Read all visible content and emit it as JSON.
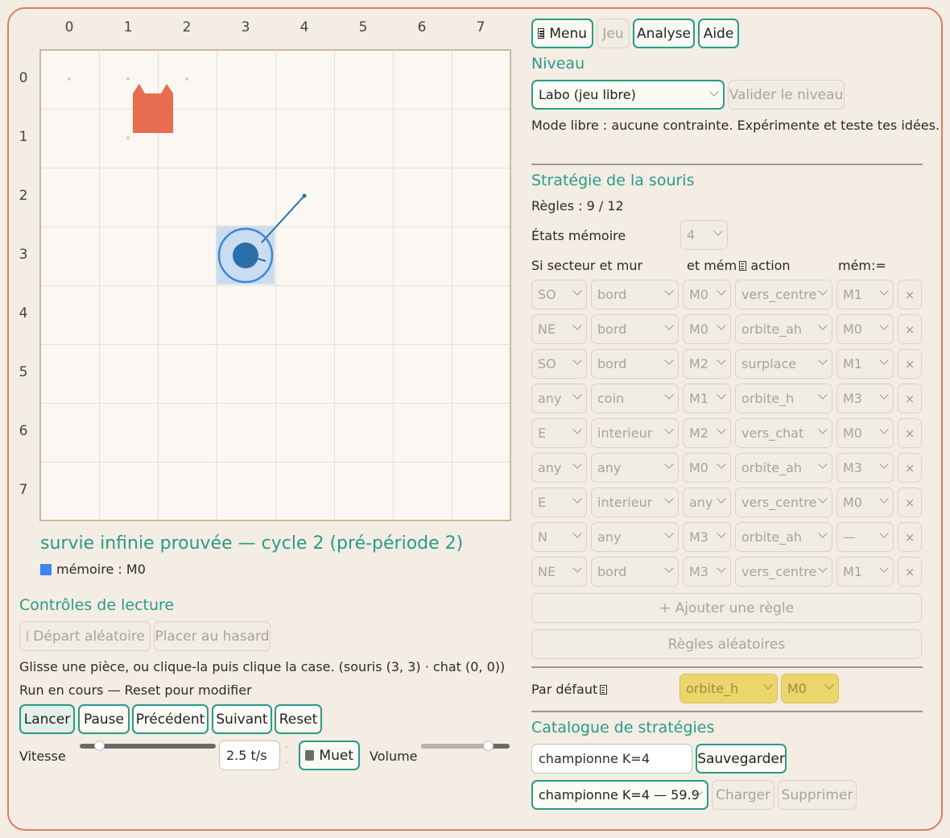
{
  "top_nav": {
    "menu": "Menu",
    "jeu": "Jeu",
    "analyse": "Analyse",
    "aide": "Aide"
  },
  "board": {
    "col_labels": [
      "0",
      "1",
      "2",
      "3",
      "4",
      "5",
      "6",
      "7"
    ],
    "row_labels": [
      "0",
      "1",
      "2",
      "3",
      "4",
      "5",
      "6",
      "7"
    ],
    "status": "survie infinie prouvée — cycle 2 (pré-période 2)",
    "memory": "mémoire : M0",
    "mouse_cell": [
      3,
      3
    ],
    "cat_cell": [
      1,
      0
    ],
    "colors": {
      "cat": "#e86c4f",
      "mouse": "#2a6fa8",
      "mouse_highlight": "#c9dcf0",
      "memory_square": "#3b82f6",
      "accent": "#2a9a8a"
    }
  },
  "controls": {
    "title": "Contrôles de lecture",
    "random_start": "Départ aléatoire",
    "place_random": "Placer au hasard",
    "hint": "Glisse une pièce, ou clique-la puis clique la case.  (souris (3, 3) · chat (0, 0))",
    "run_status": "Run en cours — Reset pour modifier",
    "lancer": "Lancer",
    "pause": "Pause",
    "precedent": "Précédent",
    "suivant": "Suivant",
    "reset": "Reset",
    "speed_label": "Vitesse",
    "speed_value": "2.5 t/s",
    "mute": "Muet",
    "volume_label": "Volume",
    "speed_level": 0.14,
    "volume_level": 0.75
  },
  "level": {
    "title": "Niveau",
    "selected": "Labo (jeu libre)",
    "validate": "Valider le niveau",
    "description": "Mode libre : aucune contrainte. Expérimente et teste tes idées."
  },
  "strategy": {
    "title": "Stratégie de la souris",
    "rules_count": "Règles : 9 / 12",
    "memory_states_label": "États mémoire",
    "memory_states_value": "4",
    "headers": {
      "sector_wall": "Si secteur et mur",
      "mem_action": "et mém",
      "action": "action",
      "mem_set": "mém:="
    },
    "rules": [
      {
        "sector": "SO",
        "wall": "bord",
        "mem": "M0",
        "action": "vers_centre",
        "set": "M1"
      },
      {
        "sector": "NE",
        "wall": "bord",
        "mem": "M0",
        "action": "orbite_ah",
        "set": "M0"
      },
      {
        "sector": "SO",
        "wall": "bord",
        "mem": "M2",
        "action": "surplace",
        "set": "M1"
      },
      {
        "sector": "any",
        "wall": "coin",
        "mem": "M1",
        "action": "orbite_h",
        "set": "M3"
      },
      {
        "sector": "E",
        "wall": "interieur",
        "mem": "M2",
        "action": "vers_chat",
        "set": "M0"
      },
      {
        "sector": "any",
        "wall": "any",
        "mem": "M0",
        "action": "orbite_ah",
        "set": "M3"
      },
      {
        "sector": "E",
        "wall": "interieur",
        "mem": "any",
        "action": "vers_centre",
        "set": "M0"
      },
      {
        "sector": "N",
        "wall": "any",
        "mem": "M3",
        "action": "orbite_ah",
        "set": "—"
      },
      {
        "sector": "NE",
        "wall": "bord",
        "mem": "M3",
        "action": "vers_centre",
        "set": "M1"
      }
    ],
    "delete_glyph": "×",
    "add_rule": "+ Ajouter une règle",
    "random_rules": "Règles aléatoires",
    "default_label": "Par défaut",
    "default_action": "orbite_h",
    "default_mem": "M0"
  },
  "catalog": {
    "title": "Catalogue de stratégies",
    "name_value": "championne K=4",
    "save": "Sauvegarder",
    "selected": "championne K=4 — 59.9",
    "load": "Charger",
    "delete": "Supprimer"
  }
}
